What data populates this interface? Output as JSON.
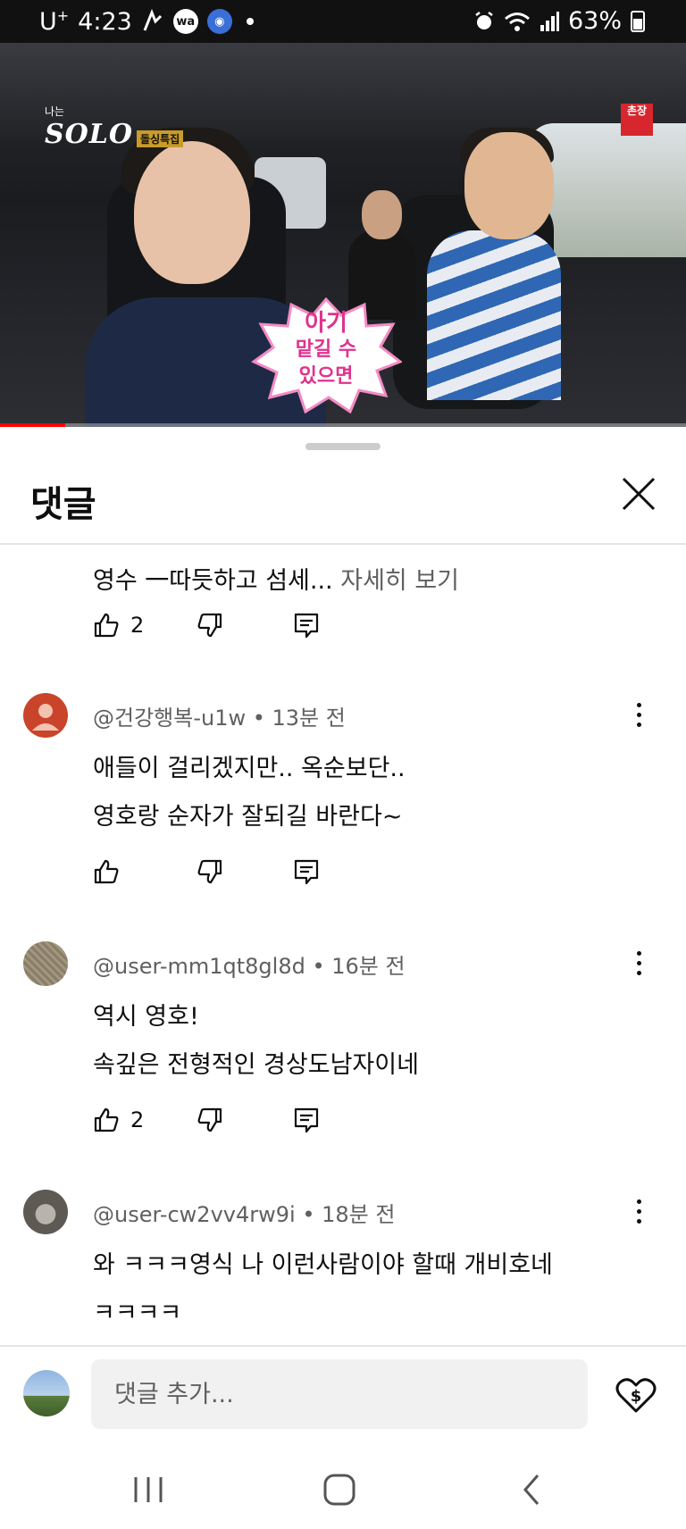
{
  "status_bar": {
    "carrier": "U",
    "carrier_sup": "+",
    "time": "4:23",
    "app_icon_1": "wa",
    "battery": "63%",
    "icons": [
      "signature-icon",
      "wa-icon",
      "owl-icon",
      "alarm-icon",
      "wifi-icon",
      "signal-icon",
      "battery-icon"
    ]
  },
  "video": {
    "logo_small": "나는",
    "logo_main": "SOLO",
    "logo_tag": "돌싱특집",
    "channel_badge": "촌장",
    "caption_line1": "아기",
    "caption_line2": "맡길 수",
    "caption_line3": "있으면",
    "progress_fraction": 0.095,
    "progress_color": "#ff0000"
  },
  "sheet": {
    "title": "댓글",
    "close_icon": "close-icon"
  },
  "comments": [
    {
      "text": "영수 一따듯하고 섬세...",
      "more_label": "자세히 보기",
      "likes": "2"
    },
    {
      "author": "@건강행복-u1w",
      "time": "13분 전",
      "lines": [
        "애들이 걸리겠지만.. 옥순보단..",
        "영호랑 순자가 잘되길 바란다~"
      ],
      "likes": "",
      "avatar_color": "#c9442a"
    },
    {
      "author": "@user-mm1qt8gl8d",
      "time": "16분 전",
      "lines": [
        "역시 영호!",
        "속깊은 전형적인 경상도남자이네"
      ],
      "likes": "2",
      "avatar_color": "#8a7d6a"
    },
    {
      "author": "@user-cw2vv4rw9i",
      "time": "18분 전",
      "lines": [
        "와 ㅋㅋㅋ영식 나 이런사람이야 할때 개비호네",
        "ㅋㅋㅋㅋ"
      ],
      "likes": "",
      "avatar_color": "#6e6e66"
    }
  ],
  "composer": {
    "placeholder": "댓글 추가...",
    "thanks_icon": "super-thanks-icon"
  },
  "nav": {
    "icons": [
      "recent-apps-icon",
      "home-icon",
      "back-icon"
    ]
  }
}
